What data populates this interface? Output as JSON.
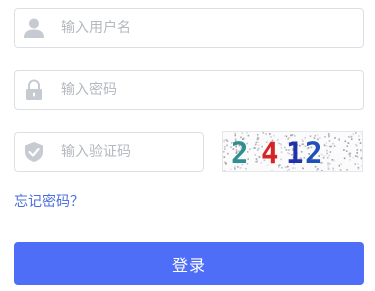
{
  "username": {
    "placeholder": "输入用户名",
    "value": "",
    "icon": "user-icon"
  },
  "password": {
    "placeholder": "输入密码",
    "value": "",
    "icon": "lock-icon"
  },
  "captcha_input": {
    "placeholder": "输入验证码",
    "value": "",
    "icon": "shield-check-icon"
  },
  "captcha_image": {
    "digits": [
      "2",
      "4",
      "1",
      "2"
    ],
    "digit_colors": [
      "#2f8f8f",
      "#d62424",
      "#2233aa",
      "#1f4fb8"
    ]
  },
  "forgot_link": "忘记密码？",
  "login_button": "登录",
  "colors": {
    "accent": "#4f6ef7",
    "link": "#4a6de0",
    "icon_gray": "#c6cad1",
    "border": "#dcdfe6"
  }
}
